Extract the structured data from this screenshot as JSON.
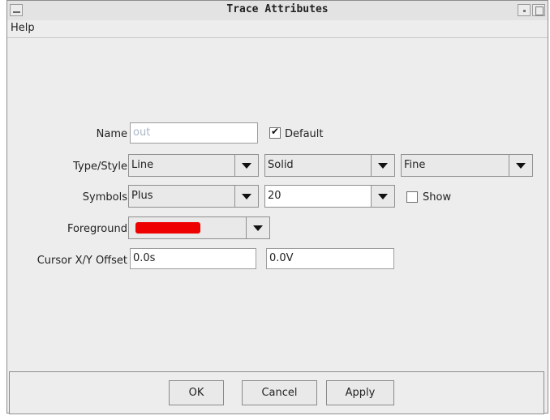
{
  "window": {
    "title": "Trace Attributes"
  },
  "menubar": {
    "items": [
      {
        "label": "Help"
      }
    ]
  },
  "form": {
    "name": {
      "label": "Name",
      "value": "out",
      "default_label": "Default",
      "default_checked": true
    },
    "type_style": {
      "label": "Type/Style",
      "type": "Line",
      "style": "Solid",
      "width": "Fine"
    },
    "symbols": {
      "label": "Symbols",
      "symbol": "Plus",
      "count": "20",
      "show_label": "Show",
      "show_checked": false
    },
    "foreground": {
      "label": "Foreground",
      "color": "#ee0000"
    },
    "cursor_offset": {
      "label": "Cursor X/Y Offset",
      "x": "0.0s",
      "y": "0.0V"
    }
  },
  "buttons": {
    "ok": "OK",
    "cancel": "Cancel",
    "apply": "Apply"
  }
}
